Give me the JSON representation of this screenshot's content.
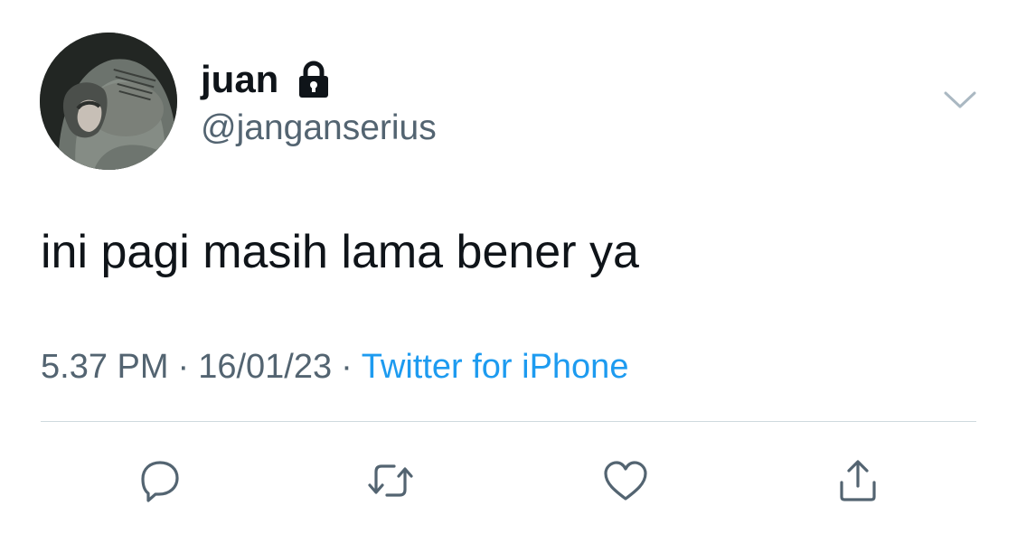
{
  "user": {
    "display_name": "juan",
    "handle": "@janganserius",
    "avatar_icon": "avatar-hooded-person",
    "protected_icon": "lock-icon"
  },
  "tweet": {
    "text": "ini pagi masih lama bener ya",
    "time": "5.37 PM",
    "date": "16/01/23",
    "separator": "·",
    "source": "Twitter for iPhone"
  },
  "actions": {
    "reply_icon": "reply-icon",
    "retweet_icon": "retweet-icon",
    "like_icon": "heart-icon",
    "share_icon": "share-icon",
    "more_icon": "chevron-down-icon"
  },
  "colors": {
    "text_primary": "#0f1419",
    "text_secondary": "#536471",
    "link": "#1d9bf0",
    "divider": "#cfd9de"
  }
}
